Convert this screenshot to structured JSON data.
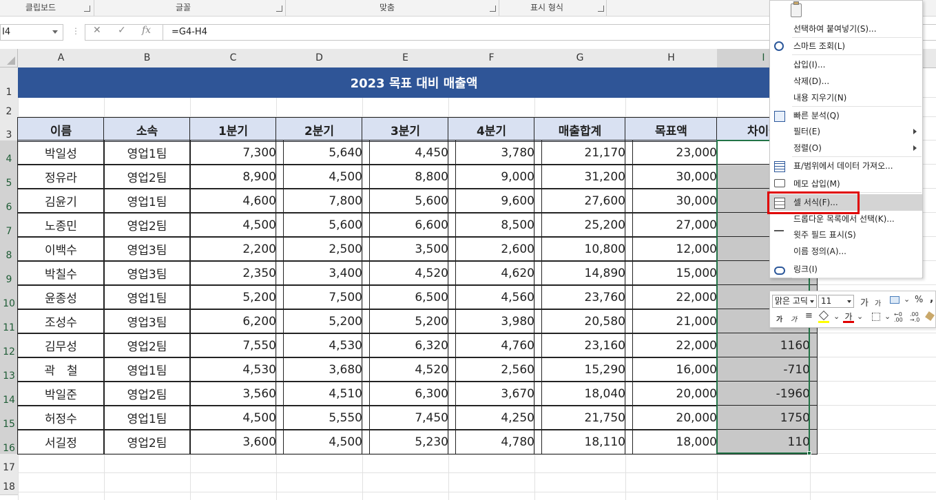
{
  "ribbon": {
    "groups": [
      "클립보드",
      "글꼴",
      "맞춤",
      "표시 형식"
    ]
  },
  "formula_bar": {
    "name_box": "I4",
    "cancel_symbol": "✕",
    "enter_symbol": "✓",
    "fx_symbol": "fx",
    "formula": "=G4-H4"
  },
  "columns": [
    "A",
    "B",
    "C",
    "D",
    "E",
    "F",
    "G",
    "H",
    "I"
  ],
  "rows": [
    "1",
    "2",
    "3",
    "4",
    "5",
    "6",
    "7",
    "8",
    "9",
    "10",
    "11",
    "12",
    "13",
    "14",
    "15",
    "16",
    "17",
    "18"
  ],
  "sheet": {
    "title": "2023 목표 대비 매출액",
    "headers": [
      "이름",
      "소속",
      "1분기",
      "2분기",
      "3분기",
      "4분기",
      "매출합계",
      "목표액",
      "차이금"
    ],
    "records": [
      [
        "박일성",
        "영업1팀",
        "7,300",
        "5,640",
        "4,450",
        "3,780",
        "21,170",
        "23,000",
        ""
      ],
      [
        "정유라",
        "영업2팀",
        "8,900",
        "4,500",
        "8,800",
        "9,000",
        "31,200",
        "30,000",
        ""
      ],
      [
        "김윤기",
        "영업1팀",
        "4,600",
        "7,800",
        "5,600",
        "9,600",
        "27,600",
        "30,000",
        ""
      ],
      [
        "노종민",
        "영업2팀",
        "4,500",
        "5,600",
        "6,600",
        "8,500",
        "25,200",
        "27,000",
        ""
      ],
      [
        "이백수",
        "영업3팀",
        "2,200",
        "2,500",
        "3,500",
        "2,600",
        "10,800",
        "12,000",
        ""
      ],
      [
        "박칠수",
        "영업3팀",
        "2,350",
        "3,400",
        "4,520",
        "4,620",
        "14,890",
        "15,000",
        ""
      ],
      [
        "윤종성",
        "영업1팀",
        "5,200",
        "7,500",
        "6,500",
        "4,560",
        "23,760",
        "22,000",
        ""
      ],
      [
        "조성수",
        "영업3팀",
        "6,200",
        "5,200",
        "5,200",
        "3,980",
        "20,580",
        "21,000",
        ""
      ],
      [
        "김무성",
        "영업2팀",
        "7,550",
        "4,530",
        "6,320",
        "4,760",
        "23,160",
        "22,000",
        "1160"
      ],
      [
        "곽　철",
        "영업1팀",
        "4,530",
        "3,680",
        "4,520",
        "2,560",
        "15,290",
        "16,000",
        "-710"
      ],
      [
        "박일준",
        "영업2팀",
        "3,560",
        "4,510",
        "6,300",
        "3,670",
        "18,040",
        "20,000",
        "-1960"
      ],
      [
        "허정수",
        "영업1팀",
        "4,500",
        "5,550",
        "7,450",
        "4,250",
        "21,750",
        "20,000",
        "1750"
      ],
      [
        "서길정",
        "영업2팀",
        "3,600",
        "4,500",
        "5,230",
        "4,780",
        "18,110",
        "18,000",
        "110"
      ]
    ]
  },
  "context_menu": {
    "items": [
      {
        "label": "선택하여 붙여넣기(S)...",
        "icon": "paste-icon"
      },
      {
        "label": "스마트 조회(L)",
        "icon": "smart-lookup-icon"
      },
      {
        "label": "삽입(I)...",
        "icon": ""
      },
      {
        "label": "삭제(D)...",
        "icon": ""
      },
      {
        "label": "내용 지우기(N)",
        "icon": ""
      },
      {
        "label": "빠른 분석(Q)",
        "icon": "quick-analysis-icon"
      },
      {
        "label": "필터(E)",
        "icon": ""
      },
      {
        "label": "정렬(O)",
        "icon": ""
      },
      {
        "label": "표/범위에서 데이터 가져오...",
        "icon": "table-icon"
      },
      {
        "label": "메모 삽입(M)",
        "icon": "comment-icon"
      },
      {
        "label": "셀 서식(F)...",
        "icon": "format-cells-icon"
      },
      {
        "label": "드롭다운 목록에서 선택(K)...",
        "icon": ""
      },
      {
        "label": "윗주 필드 표시(S)",
        "icon": "phonetic-icon"
      },
      {
        "label": "이름 정의(A)...",
        "icon": ""
      },
      {
        "label": "링크(I)",
        "icon": "link-icon"
      }
    ],
    "highlight_color": "#e00000"
  },
  "mini_toolbar": {
    "font_name": "맑은 고딕",
    "font_size": "11",
    "percent": "%",
    "comma": ","
  },
  "colors": {
    "title_bg": "#2f5597",
    "header_bg": "#d9e1f2",
    "selection_fill": "#c8c8c8",
    "selection_border": "#217346"
  }
}
